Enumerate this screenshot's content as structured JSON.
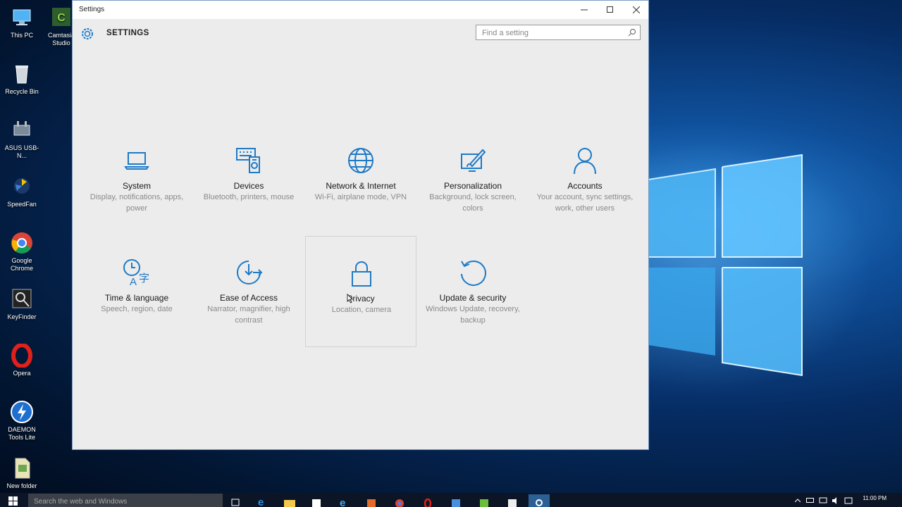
{
  "desktop": {
    "icons": [
      {
        "label": "This PC"
      },
      {
        "label": "Camtasia Studio"
      },
      {
        "label": "Recycle Bin"
      },
      {
        "label": "ASUS USB-N..."
      },
      {
        "label": "SpeedFan"
      },
      {
        "label": "Google Chrome"
      },
      {
        "label": "KeyFinder"
      },
      {
        "label": "Opera"
      },
      {
        "label": "DAEMON Tools Lite"
      },
      {
        "label": "New folder"
      }
    ]
  },
  "window": {
    "title": "Settings",
    "header": "SETTINGS",
    "search_placeholder": "Find a setting",
    "accent": "#1e7ac7"
  },
  "tiles": [
    {
      "title": "System",
      "subtitle": "Display, notifications, apps, power",
      "icon": "laptop-icon"
    },
    {
      "title": "Devices",
      "subtitle": "Bluetooth, printers, mouse",
      "icon": "devices-icon"
    },
    {
      "title": "Network & Internet",
      "subtitle": "Wi-Fi, airplane mode, VPN",
      "icon": "globe-icon"
    },
    {
      "title": "Personalization",
      "subtitle": "Background, lock screen, colors",
      "icon": "paintbrush-icon"
    },
    {
      "title": "Accounts",
      "subtitle": "Your account, sync settings, work, other users",
      "icon": "person-icon"
    },
    {
      "title": "Time & language",
      "subtitle": "Speech, region, date",
      "icon": "time-language-icon"
    },
    {
      "title": "Ease of Access",
      "subtitle": "Narrator, magnifier, high contrast",
      "icon": "ease-of-access-icon"
    },
    {
      "title": "Privacy",
      "subtitle": "Location, camera",
      "icon": "lock-icon"
    },
    {
      "title": "Update & security",
      "subtitle": "Windows Update, recovery, backup",
      "icon": "refresh-icon"
    }
  ],
  "taskbar": {
    "search_placeholder": "Search the web and Windows",
    "clock_time": "11:00 PM"
  }
}
